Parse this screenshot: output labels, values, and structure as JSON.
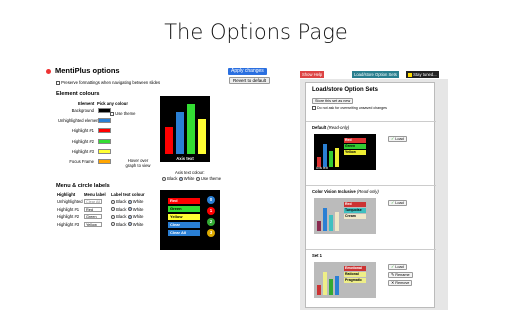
{
  "slide": {
    "title": "The Options Page"
  },
  "left": {
    "app_title": "MentiPlus options",
    "apply_button": "Apply changes",
    "revert_button": "Revert to default",
    "preserve_label": "Preserve formattings when navigating between slides",
    "element_colours_heading": "Element colours",
    "element_col": "Element",
    "pick_col": "Pick any colour",
    "rows": [
      {
        "label": "Background",
        "color": "#000000"
      },
      {
        "label": "Unhighlighted element",
        "color": "#2a7fd4"
      },
      {
        "label": "Highlight #1",
        "color": "#ff0000"
      },
      {
        "label": "Highlight #2",
        "color": "#33dd33"
      },
      {
        "label": "Highlight #3",
        "color": "#ffff33"
      },
      {
        "label": "Focus Frame",
        "color": "#ffa500"
      }
    ],
    "use_theme": "Use theme",
    "hover_hint": "Hover over graph to view",
    "axis_text": "Axis text",
    "axis_colour_label": "Axis text colour:",
    "axis_options": [
      "Black",
      "White",
      "Use theme"
    ],
    "menu_heading": "Menu & circle labels",
    "menu_cols": {
      "highlight": "Highlight",
      "menu": "Menu label",
      "label_colour": "Label text colour"
    },
    "menu_rows": [
      {
        "name": "Unhighlighted",
        "value": "Clear All",
        "black": "Black",
        "white": "White"
      },
      {
        "name": "Highlight #1",
        "value": "Red",
        "black": "Black",
        "white": "White"
      },
      {
        "name": "Highlight #2",
        "value": "Green",
        "black": "Black",
        "white": "White"
      },
      {
        "name": "Highlight #3",
        "value": "Yellow",
        "black": "Black",
        "white": "White"
      }
    ],
    "chart_bars": [
      {
        "color": "#ff0000",
        "value": 0.55
      },
      {
        "color": "#2a7fd4",
        "value": 0.85
      },
      {
        "color": "#33dd33",
        "value": 1.0
      },
      {
        "color": "#ffff33",
        "value": 0.7
      }
    ],
    "menu_preview": [
      {
        "label": "Red",
        "color": "#ff0000"
      },
      {
        "label": "Green",
        "color": "#33dd33"
      },
      {
        "label": "Yellow",
        "color": "#ffff33"
      },
      {
        "label": "Clear",
        "color": "#2a7fd4"
      },
      {
        "label": "Clear All",
        "color": "#2a7fd4"
      }
    ],
    "circles": [
      {
        "label": "0",
        "color": "#2a7fd4"
      },
      {
        "label": "1",
        "color": "#ff0000"
      },
      {
        "label": "2",
        "color": "#33aa33"
      },
      {
        "label": "3",
        "color": "#ddaa00"
      }
    ]
  },
  "right": {
    "tab_help": "Show Help",
    "tab_load": "Load/store Option Sets",
    "tab_stay": "Stay tuned...",
    "heading": "Load/store Option Sets",
    "store_button": "Store this set as new",
    "no_overwrite": "Do not ask for overwriting unsaved changes",
    "sets": [
      {
        "name": "Default",
        "note": "(Read-only)",
        "labels": [
          "Red",
          "Green",
          "Yellow"
        ],
        "axis": "Axis text"
      },
      {
        "name": "Color Vision Inclusive",
        "note": "(Read-only)",
        "labels": [
          "Red",
          "Turquoise",
          "Cream"
        ],
        "axis": ""
      },
      {
        "name": "Set 1",
        "note": "",
        "labels": [
          "Emotional",
          "Rational",
          "Pragmatic"
        ],
        "axis": ""
      }
    ],
    "load_button": "Load",
    "rename_button": "Rename",
    "remove_button": "Remove"
  }
}
